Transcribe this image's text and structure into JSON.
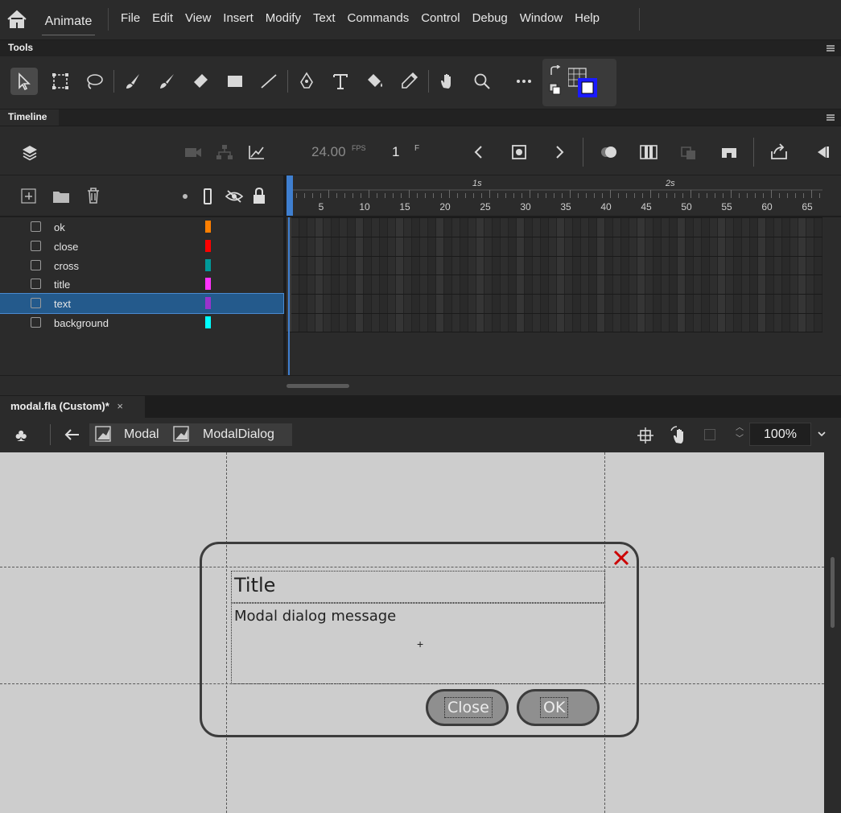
{
  "app": {
    "name": "Animate",
    "menu": [
      "File",
      "Edit",
      "View",
      "Insert",
      "Modify",
      "Text",
      "Commands",
      "Control",
      "Debug",
      "Window",
      "Help"
    ]
  },
  "tools_panel": {
    "title": "Tools",
    "tools": [
      "selection-tool",
      "free-transform-tool",
      "lasso-tool",
      "paint-brush-tool",
      "brush-tool",
      "eraser-tool",
      "rectangle-tool",
      "line-tool",
      "pen-tool",
      "text-tool",
      "paint-bucket-tool",
      "eyedropper-tool",
      "hand-tool",
      "zoom-tool",
      "more-tools"
    ]
  },
  "timeline": {
    "title": "Timeline",
    "fps": "24.00",
    "fps_unit": "FPS",
    "frame": "1",
    "frame_unit": "F",
    "ruler_seconds": [
      "1s",
      "2s"
    ],
    "ruler_numbers": [
      "5",
      "10",
      "15",
      "20",
      "25",
      "30",
      "35",
      "40",
      "45",
      "50",
      "55",
      "60",
      "65"
    ],
    "layers": [
      {
        "name": "ok",
        "color": "#ff7f00",
        "selected": false
      },
      {
        "name": "close",
        "color": "#ff0000",
        "selected": false
      },
      {
        "name": "cross",
        "color": "#009999",
        "selected": false
      },
      {
        "name": "title",
        "color": "#ff33ff",
        "selected": false
      },
      {
        "name": "text",
        "color": "#9933cc",
        "selected": true
      },
      {
        "name": "background",
        "color": "#00ffff",
        "selected": false
      }
    ]
  },
  "document": {
    "tab_label": "modal.fla (Custom)*",
    "breadcrumbs": [
      "Modal",
      "ModalDialog"
    ],
    "zoom": "100%"
  },
  "stage": {
    "dialog": {
      "title": "Title",
      "message": "Modal dialog message",
      "close_label": "Close",
      "ok_label": "OK",
      "close_icon_color": "#cc0000"
    }
  }
}
